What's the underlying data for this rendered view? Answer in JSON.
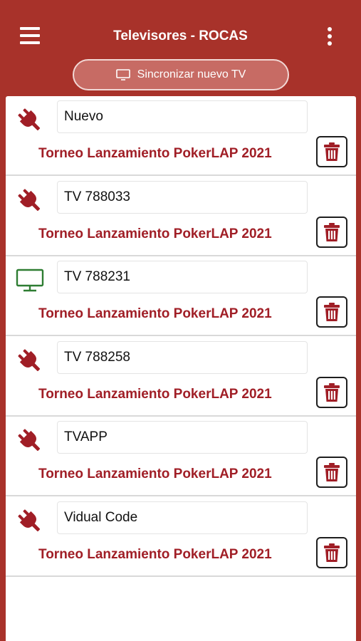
{
  "header": {
    "title": "Televisores - ROCAS",
    "menu_icon": "hamburger-menu-icon",
    "more_icon": "vertical-dots-icon"
  },
  "sync_button": {
    "label": "Sincronizar nuevo TV",
    "icon": "tv-icon"
  },
  "colors": {
    "brand": "#a8322a",
    "tournament_text": "#a01e26",
    "disconnected": "#a01e26",
    "connected": "#2e7d32"
  },
  "tvs": [
    {
      "name": "Nuevo",
      "tournament": "Torneo Lanzamiento PokerLAP 2021",
      "status": "disconnected",
      "status_icon": "plug-icon"
    },
    {
      "name": "TV 788033",
      "tournament": "Torneo Lanzamiento PokerLAP 2021",
      "status": "disconnected",
      "status_icon": "plug-icon"
    },
    {
      "name": "TV 788231",
      "tournament": "Torneo Lanzamiento PokerLAP 2021",
      "status": "connected",
      "status_icon": "monitor-icon"
    },
    {
      "name": "TV 788258",
      "tournament": "Torneo Lanzamiento PokerLAP 2021",
      "status": "disconnected",
      "status_icon": "plug-icon"
    },
    {
      "name": "TVAPP",
      "tournament": "Torneo Lanzamiento PokerLAP 2021",
      "status": "disconnected",
      "status_icon": "plug-icon"
    },
    {
      "name": "Vidual Code",
      "tournament": "Torneo Lanzamiento PokerLAP 2021",
      "status": "disconnected",
      "status_icon": "plug-icon"
    }
  ]
}
